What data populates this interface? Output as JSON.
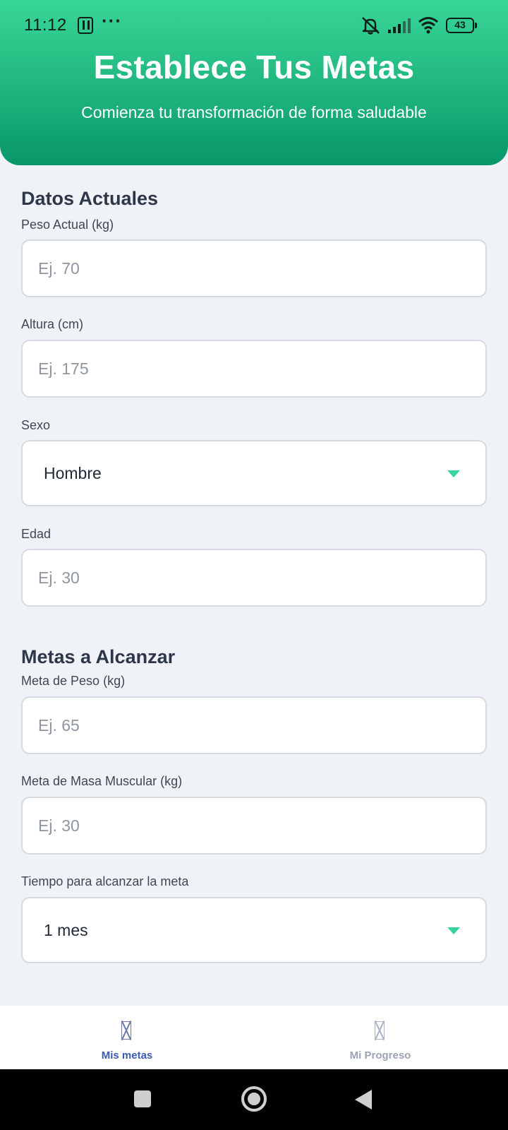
{
  "status_bar": {
    "time": "11:12",
    "more_indicator": "···",
    "battery": "43",
    "icons": [
      "nfc-icon",
      "mute-icon",
      "signal-icon",
      "wifi-icon",
      "battery-icon"
    ]
  },
  "header": {
    "title": "Establece Tus Metas",
    "subtitle": "Comienza tu transformación de forma saludable"
  },
  "current_data": {
    "section_title": "Datos Actuales",
    "weight": {
      "label": "Peso Actual (kg)",
      "placeholder": "Ej. 70"
    },
    "height": {
      "label": "Altura (cm)",
      "placeholder": "Ej. 175"
    },
    "sex": {
      "label": "Sexo",
      "value": "Hombre"
    },
    "age": {
      "label": "Edad",
      "placeholder": "Ej. 30"
    }
  },
  "goals": {
    "section_title": "Metas a Alcanzar",
    "weight_goal": {
      "label": "Meta de Peso (kg)",
      "placeholder": "Ej. 65"
    },
    "muscle_goal": {
      "label": "Meta de Masa Muscular (kg)",
      "placeholder": "Ej. 30"
    },
    "time": {
      "label": "Tiempo para alcanzar la meta",
      "value": "1 mes"
    }
  },
  "bottom_nav": {
    "items": [
      {
        "label": "Mis metas",
        "active": true
      },
      {
        "label": "Mi Progreso",
        "active": false
      }
    ]
  },
  "colors": {
    "header_gradient_top": "#38d698",
    "header_gradient_bottom": "#089669",
    "accent": "#34d3a0",
    "background": "#eff2f7",
    "active_nav": "#3b5bb0"
  }
}
